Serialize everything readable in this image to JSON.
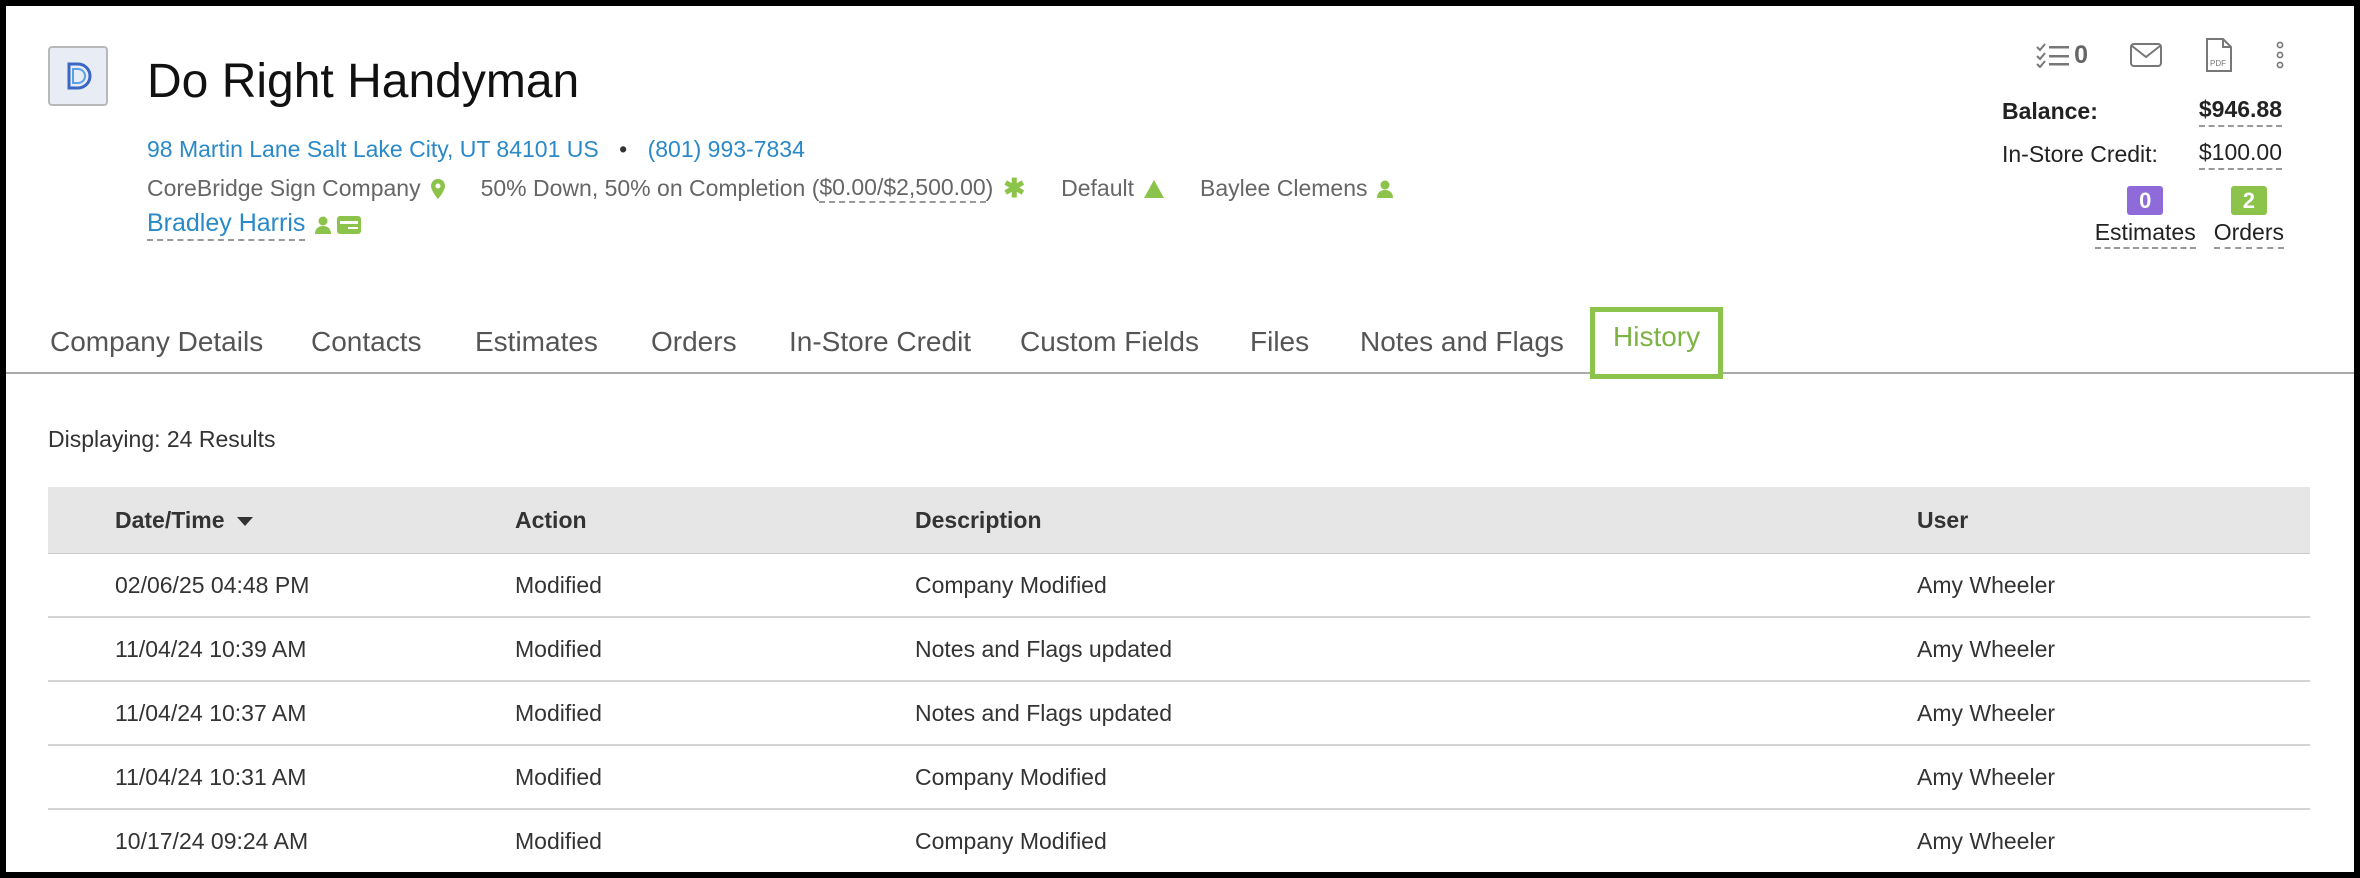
{
  "company": {
    "name": "Do Right Handyman",
    "address": "98 Martin Lane Salt Lake City, UT 84101 US",
    "phone": "(801) 993-7834",
    "separator": "•",
    "location": "CoreBridge Sign Company",
    "terms_text": "50% Down, 50% on Completion (",
    "terms_amount": "$0.00/$2,500.00",
    "terms_close": ")",
    "tax": "Default",
    "salesperson": "Baylee Clemens",
    "contact": "Bradley Harris"
  },
  "header_icons": {
    "tasks_count": "0"
  },
  "balance": {
    "balance_label": "Balance:",
    "balance_value": "$946.88",
    "credit_label": "In-Store Credit:",
    "credit_value": "$100.00"
  },
  "counts": [
    {
      "value": "0",
      "label": "Estimates",
      "color": "#8e6bd8"
    },
    {
      "value": "2",
      "label": "Orders",
      "color": "#8cc34a"
    }
  ],
  "tabs": [
    {
      "label": "Company Details"
    },
    {
      "label": "Contacts"
    },
    {
      "label": "Estimates"
    },
    {
      "label": "Orders"
    },
    {
      "label": "In-Store Credit"
    },
    {
      "label": "Custom Fields"
    },
    {
      "label": "Files"
    },
    {
      "label": "Notes and Flags"
    },
    {
      "label": "History",
      "active": true
    }
  ],
  "results": {
    "displaying": "Displaying: 24 Results",
    "columns": [
      "Date/Time",
      "Action",
      "Description",
      "User"
    ],
    "rows": [
      [
        "02/06/25 04:48 PM",
        "Modified",
        "Company Modified",
        "Amy Wheeler"
      ],
      [
        "11/04/24 10:39 AM",
        "Modified",
        "Notes and Flags updated",
        "Amy Wheeler"
      ],
      [
        "11/04/24 10:37 AM",
        "Modified",
        "Notes and Flags updated",
        "Amy Wheeler"
      ],
      [
        "11/04/24 10:31 AM",
        "Modified",
        "Company Modified",
        "Amy Wheeler"
      ],
      [
        "10/17/24 09:24 AM",
        "Modified",
        "Company Modified",
        "Amy Wheeler"
      ]
    ]
  },
  "colors": {
    "accent_green": "#8cc34a",
    "link_blue": "#2a89c7",
    "estimates_purple": "#8e6bd8"
  }
}
